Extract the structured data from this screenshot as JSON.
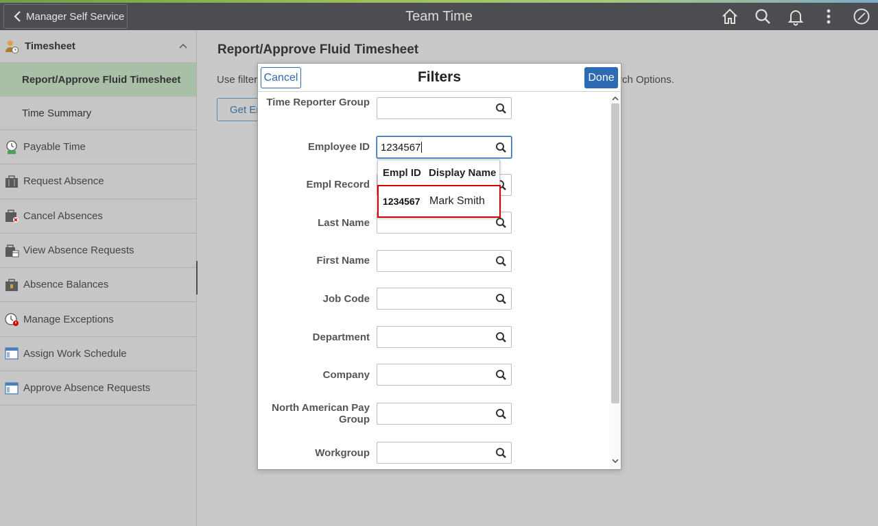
{
  "header": {
    "back_label": "Manager Self Service",
    "title": "Team Time",
    "icons": [
      "home-icon",
      "search-icon",
      "bell-icon",
      "more-vertical-icon",
      "compass-icon"
    ]
  },
  "sidebar": {
    "group_label": "Timesheet",
    "sub_items": [
      "Report/Approve Fluid Timesheet",
      "Time Summary"
    ],
    "items": [
      "Payable Time",
      "Request Absence",
      "Cancel Absences",
      "View Absence Requests",
      "Absence Balances",
      "Manage Exceptions",
      "Assign Work Schedule",
      "Approve Absence Requests"
    ]
  },
  "content": {
    "page_title": "Report/Approve Fluid Timesheet",
    "intro_left": "Use filter",
    "intro_right": "rch Options.",
    "get_button": "Get Em"
  },
  "modal": {
    "cancel_label": "Cancel",
    "title": "Filters",
    "done_label": "Done",
    "fields": [
      {
        "label": "Time Reporter Group",
        "value": ""
      },
      {
        "label": "Employee ID",
        "value": "1234567"
      },
      {
        "label": "Empl Record",
        "value": ""
      },
      {
        "label": "Last Name",
        "value": ""
      },
      {
        "label": "First Name",
        "value": ""
      },
      {
        "label": "Job Code",
        "value": ""
      },
      {
        "label": "Department",
        "value": ""
      },
      {
        "label": "Company",
        "value": ""
      },
      {
        "label": "North American Pay Group",
        "value": ""
      },
      {
        "label": "Workgroup",
        "value": ""
      }
    ],
    "dropdown": {
      "headers": [
        "Empl ID",
        "Display Name"
      ],
      "rows": [
        {
          "empl_id": "1234567",
          "display_name": "Mark Smith"
        }
      ]
    }
  },
  "colors": {
    "header_bg": "#4b4d50",
    "primary_blue": "#2c6ab3",
    "active_nav": "#a9bfa8",
    "highlight_red": "#d40000"
  }
}
